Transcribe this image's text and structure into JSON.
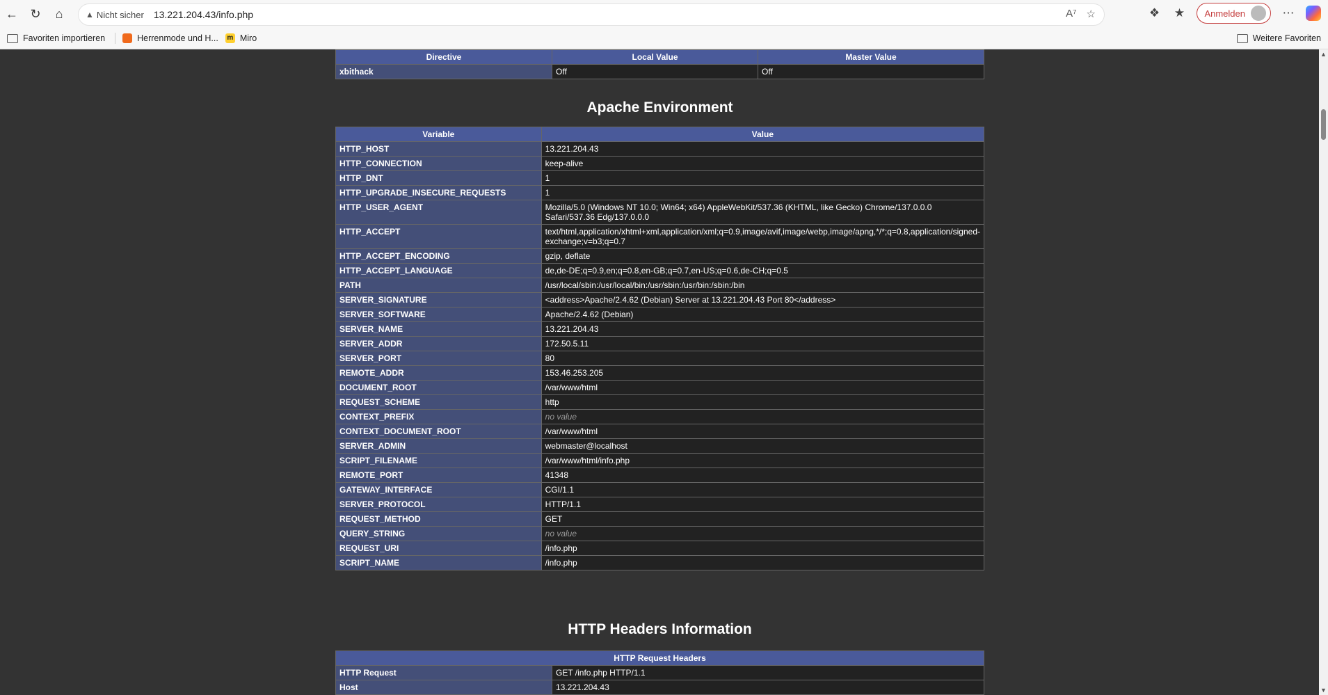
{
  "browser": {
    "security_label": "Nicht sicher",
    "url": "13.221.204.43/info.php",
    "signin_label": "Anmelden"
  },
  "favorites": {
    "items": [
      "Favoriten importieren",
      "Herrenmode und H...",
      "Miro"
    ],
    "more": "Weitere Favoriten"
  },
  "prev_table": {
    "headers": [
      "Directive",
      "Local Value",
      "Master Value"
    ],
    "last_row": [
      "xbithack",
      "Off",
      "Off"
    ]
  },
  "apache_env": {
    "title": "Apache Environment",
    "headers": [
      "Variable",
      "Value"
    ],
    "rows": [
      [
        "HTTP_HOST",
        "13.221.204.43"
      ],
      [
        "HTTP_CONNECTION",
        "keep-alive"
      ],
      [
        "HTTP_DNT",
        "1"
      ],
      [
        "HTTP_UPGRADE_INSECURE_REQUESTS",
        "1"
      ],
      [
        "HTTP_USER_AGENT",
        "Mozilla/5.0 (Windows NT 10.0; Win64; x64) AppleWebKit/537.36 (KHTML, like Gecko) Chrome/137.0.0.0 Safari/537.36 Edg/137.0.0.0"
      ],
      [
        "HTTP_ACCEPT",
        "text/html,application/xhtml+xml,application/xml;q=0.9,image/avif,image/webp,image/apng,*/*;q=0.8,application/signed-exchange;v=b3;q=0.7"
      ],
      [
        "HTTP_ACCEPT_ENCODING",
        "gzip, deflate"
      ],
      [
        "HTTP_ACCEPT_LANGUAGE",
        "de,de-DE;q=0.9,en;q=0.8,en-GB;q=0.7,en-US;q=0.6,de-CH;q=0.5"
      ],
      [
        "PATH",
        "/usr/local/sbin:/usr/local/bin:/usr/sbin:/usr/bin:/sbin:/bin"
      ],
      [
        "SERVER_SIGNATURE",
        "<address>Apache/2.4.62 (Debian) Server at 13.221.204.43 Port 80</address>"
      ],
      [
        "SERVER_SOFTWARE",
        "Apache/2.4.62 (Debian)"
      ],
      [
        "SERVER_NAME",
        "13.221.204.43"
      ],
      [
        "SERVER_ADDR",
        "172.50.5.11"
      ],
      [
        "SERVER_PORT",
        "80"
      ],
      [
        "REMOTE_ADDR",
        "153.46.253.205"
      ],
      [
        "DOCUMENT_ROOT",
        "/var/www/html"
      ],
      [
        "REQUEST_SCHEME",
        "http"
      ],
      [
        "CONTEXT_PREFIX",
        "no value"
      ],
      [
        "CONTEXT_DOCUMENT_ROOT",
        "/var/www/html"
      ],
      [
        "SERVER_ADMIN",
        "webmaster@localhost"
      ],
      [
        "SCRIPT_FILENAME",
        "/var/www/html/info.php"
      ],
      [
        "REMOTE_PORT",
        "41348"
      ],
      [
        "GATEWAY_INTERFACE",
        "CGI/1.1"
      ],
      [
        "SERVER_PROTOCOL",
        "HTTP/1.1"
      ],
      [
        "REQUEST_METHOD",
        "GET"
      ],
      [
        "QUERY_STRING",
        "no value"
      ],
      [
        "REQUEST_URI",
        "/info.php"
      ],
      [
        "SCRIPT_NAME",
        "/info.php"
      ]
    ]
  },
  "http_headers": {
    "title": "HTTP Headers Information",
    "header": "HTTP Request Headers",
    "rows": [
      [
        "HTTP Request",
        "GET /info.php HTTP/1.1"
      ],
      [
        "Host",
        "13.221.204.43"
      ]
    ]
  }
}
